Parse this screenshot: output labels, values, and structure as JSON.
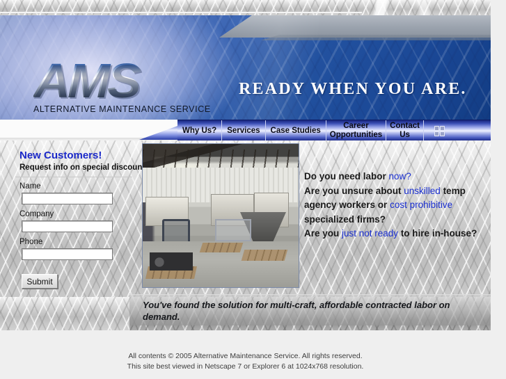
{
  "site": {
    "logo_text": "AMS",
    "logo_subtitle": "ALTERNATIVE MAINTENANCE SERVICE",
    "banner_tagline": "READY WHEN YOU ARE."
  },
  "nav": {
    "items": [
      {
        "label": "Why Us?"
      },
      {
        "label": "Services"
      },
      {
        "label": "Case Studies"
      },
      {
        "label_line1": "Career",
        "label_line2": "Opportunities"
      },
      {
        "label_line1": "Contact",
        "label_line2": "Us"
      }
    ],
    "grip_icon": "grip-dots-icon"
  },
  "sidebar": {
    "heading": "New Customers!",
    "subheading": "Request info on special discounts.",
    "fields": [
      {
        "label": "Name",
        "value": "",
        "placeholder": ""
      },
      {
        "label": "Company",
        "value": "",
        "placeholder": ""
      },
      {
        "label": "Phone",
        "value": "",
        "placeholder": ""
      }
    ],
    "submit_label": "Submit"
  },
  "main": {
    "photo_alt": "machine shop interior with industrial equipment",
    "copy": {
      "line1_a": "Do you need labor ",
      "line1_hi": "now?",
      "line2_a": "Are you unsure about ",
      "line2_hi": "unskilled",
      "line2_b": " temp",
      "line3_a": "agency workers or ",
      "line3_hi": "cost prohibitive",
      "line4": "specialized firms?",
      "line5_a": "Are you ",
      "line5_hi": "just not ready",
      "line5_b": " to hire in-house?"
    },
    "tagline": "You've found the solution for multi-craft, affordable contracted labor on demand."
  },
  "footer": {
    "line1": "All contents © 2005 Alternative Maintenance Service. All rights reserved.",
    "line2": "This site best viewed in Netscape 7 or Explorer 6 at 1024x768 resolution."
  },
  "colors": {
    "accent_blue": "#1a2fd0",
    "heading_blue": "#1a28c8",
    "banner_blue": "#22519f",
    "nav_blue": "#3c50b6",
    "page_bg": "#efefef"
  }
}
